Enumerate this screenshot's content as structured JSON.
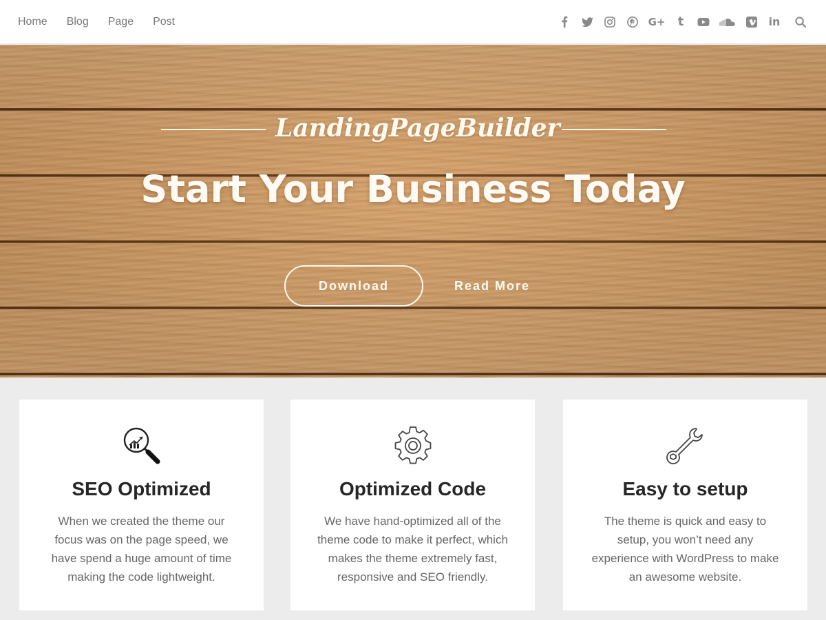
{
  "nav": {
    "items": [
      {
        "label": "Home"
      },
      {
        "label": "Blog"
      },
      {
        "label": "Page"
      },
      {
        "label": "Post"
      }
    ]
  },
  "social": {
    "icons": [
      "facebook-icon",
      "twitter-icon",
      "instagram-icon",
      "pinterest-icon",
      "google-plus-icon",
      "tumblr-icon",
      "youtube-icon",
      "soundcloud-icon",
      "vimeo-icon",
      "linkedin-icon",
      "search-icon"
    ],
    "icon_color": "#8a8a8a"
  },
  "hero": {
    "brand": "LandingPageBuilder",
    "title": "Start Your Business Today",
    "download_label": "Download",
    "readmore_label": "Read More",
    "background": "wood-planks"
  },
  "features": [
    {
      "icon": "seo-magnifier-icon",
      "title": "SEO Optimized",
      "text": "When we created the theme our focus was on the page speed, we have spend a huge amount of time making the code lightweight."
    },
    {
      "icon": "gear-icon",
      "title": "Optimized Code",
      "text": "We have hand-optimized all of the theme code to make it perfect, which makes the theme extremely fast, responsive and SEO friendly."
    },
    {
      "icon": "wrench-icon",
      "title": "Easy to setup",
      "text": "The theme is quick and easy to setup, you won’t need any experience with WordPress to make an awesome website."
    }
  ],
  "colors": {
    "page_bg": "#ececec",
    "card_bg": "#ffffff",
    "heading": "#262626",
    "body_text": "#666666",
    "nav_text": "#777777"
  }
}
